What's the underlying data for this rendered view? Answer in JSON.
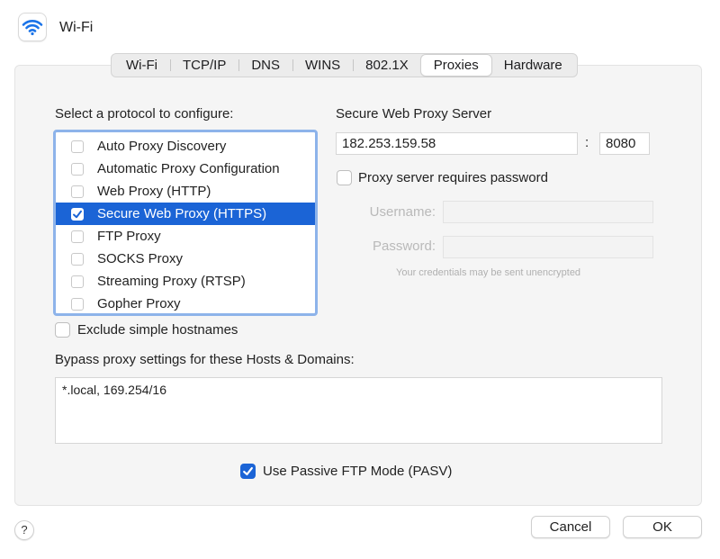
{
  "window": {
    "title": "Wi-Fi"
  },
  "tabs": [
    {
      "label": "Wi-Fi"
    },
    {
      "label": "TCP/IP"
    },
    {
      "label": "DNS"
    },
    {
      "label": "WINS"
    },
    {
      "label": "802.1X"
    },
    {
      "label": "Proxies",
      "active": true
    },
    {
      "label": "Hardware"
    }
  ],
  "protocols": {
    "heading": "Select a protocol to configure:",
    "items": [
      {
        "label": "Auto Proxy Discovery",
        "checked": false
      },
      {
        "label": "Automatic Proxy Configuration",
        "checked": false
      },
      {
        "label": "Web Proxy (HTTP)",
        "checked": false
      },
      {
        "label": "Secure Web Proxy (HTTPS)",
        "checked": true,
        "selected": true
      },
      {
        "label": "FTP Proxy",
        "checked": false
      },
      {
        "label": "SOCKS Proxy",
        "checked": false
      },
      {
        "label": "Streaming Proxy (RTSP)",
        "checked": false
      },
      {
        "label": "Gopher Proxy",
        "checked": false
      }
    ]
  },
  "server": {
    "heading": "Secure Web Proxy Server",
    "host": "182.253.159.58",
    "separator": ":",
    "port": "8080",
    "requires_password_label": "Proxy server requires password",
    "requires_password_checked": false,
    "username_label": "Username:",
    "username_value": "",
    "password_label": "Password:",
    "password_value": "",
    "hint": "Your credentials may be sent unencrypted"
  },
  "exclude_simple": {
    "label": "Exclude simple hostnames",
    "checked": false
  },
  "bypass": {
    "label": "Bypass proxy settings for these Hosts & Domains:",
    "value": "*.local, 169.254/16"
  },
  "passive_ftp": {
    "label": "Use Passive FTP Mode (PASV)",
    "checked": true
  },
  "buttons": {
    "help": "?",
    "cancel": "Cancel",
    "ok": "OK"
  },
  "colors": {
    "accent": "#1b64d6",
    "focus_ring": "#8db3ea",
    "wifi_icon": "#1a73e8"
  },
  "icons": {
    "window": "wifi-icon",
    "check": "checkmark-icon"
  }
}
